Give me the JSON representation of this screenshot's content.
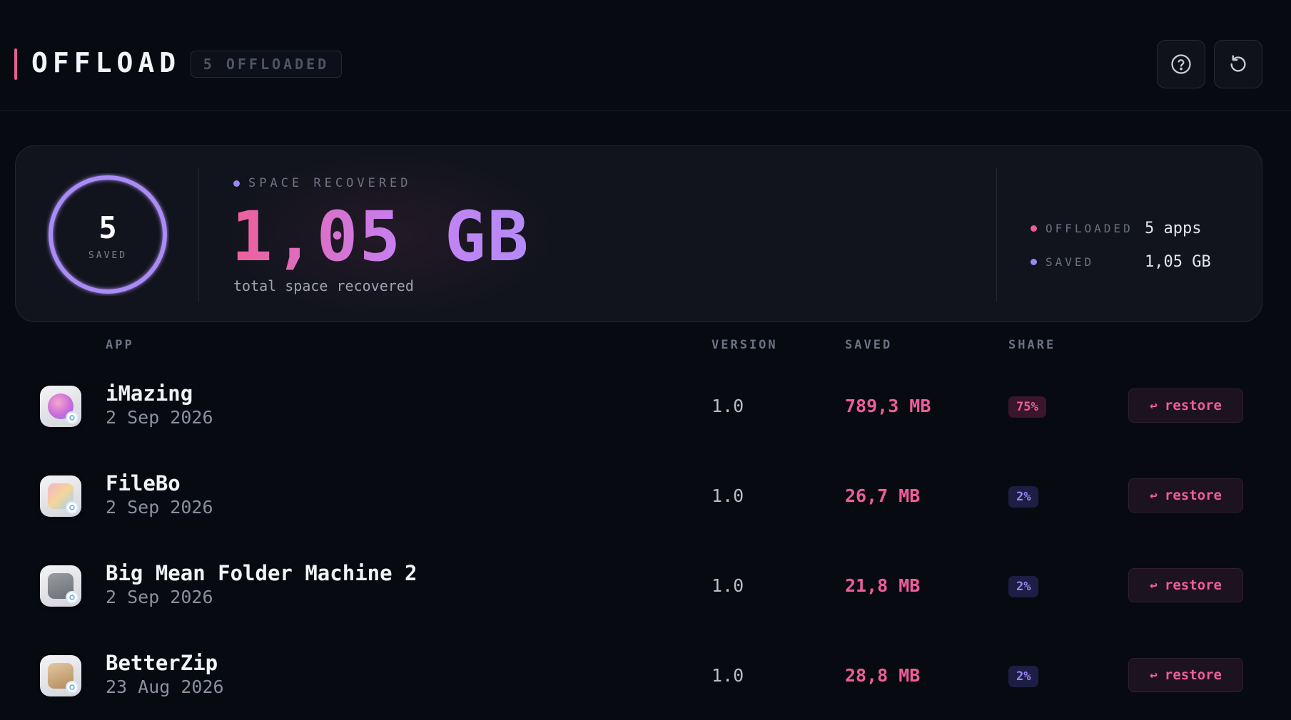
{
  "header": {
    "title": "OFFLOAD",
    "badge": "5 OFFLOADED",
    "help_icon": "help-circle-icon",
    "refresh_icon": "refresh-icon"
  },
  "summary": {
    "ring_count": "5",
    "ring_label": "SAVED",
    "space_label": "SPACE RECOVERED",
    "total": "1,05 GB",
    "total_caption": "total space recovered",
    "stats": [
      {
        "key": "OFFLOADED",
        "value": "5 apps"
      },
      {
        "key": "SAVED",
        "value": "1,05 GB"
      }
    ]
  },
  "table": {
    "headers": {
      "app": "APP",
      "version": "VERSION",
      "saved": "SAVED",
      "share": "SHARE"
    },
    "restore_label": "restore",
    "rows": [
      {
        "name": "iMazing",
        "date": "2 Sep 2026",
        "version": "1.0",
        "saved": "789,3 MB",
        "share": "75%"
      },
      {
        "name": "FileBo",
        "date": "2 Sep 2026",
        "version": "1.0",
        "saved": "26,7 MB",
        "share": "2%"
      },
      {
        "name": "Big Mean Folder Machine 2",
        "date": "2 Sep 2026",
        "version": "1.0",
        "saved": "21,8 MB",
        "share": "2%"
      },
      {
        "name": "BetterZip",
        "date": "23 Aug 2026",
        "version": "1.0",
        "saved": "28,8 MB",
        "share": "2%"
      }
    ]
  },
  "colors": {
    "background": "#080a12",
    "card": "#12141d",
    "accent_pink": "#ec5b98",
    "accent_violet": "#9b86f2"
  }
}
